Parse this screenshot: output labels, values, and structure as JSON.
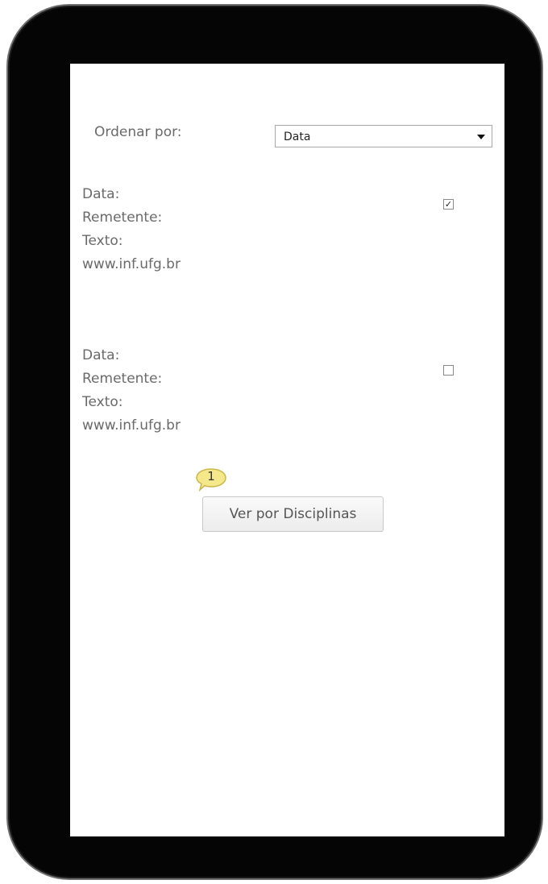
{
  "sort": {
    "label": "Ordenar por:",
    "selected": "Data"
  },
  "messages": [
    {
      "date_label": "Data:",
      "sender_label": "Remetente:",
      "text_label": "Texto:",
      "link": "www.inf.ufg.br",
      "checked": true,
      "check_glyph": "✓"
    },
    {
      "date_label": "Data:",
      "sender_label": "Remetente:",
      "text_label": "Texto:",
      "link": "www.inf.ufg.br",
      "checked": false,
      "check_glyph": ""
    }
  ],
  "view_button": {
    "label": "Ver por Disciplinas"
  },
  "annotation": {
    "number": "1",
    "color": "#f5e88a"
  },
  "colors": {
    "device_frame": "#050505",
    "screen": "#ffffff",
    "text": "#6a6a6a"
  }
}
